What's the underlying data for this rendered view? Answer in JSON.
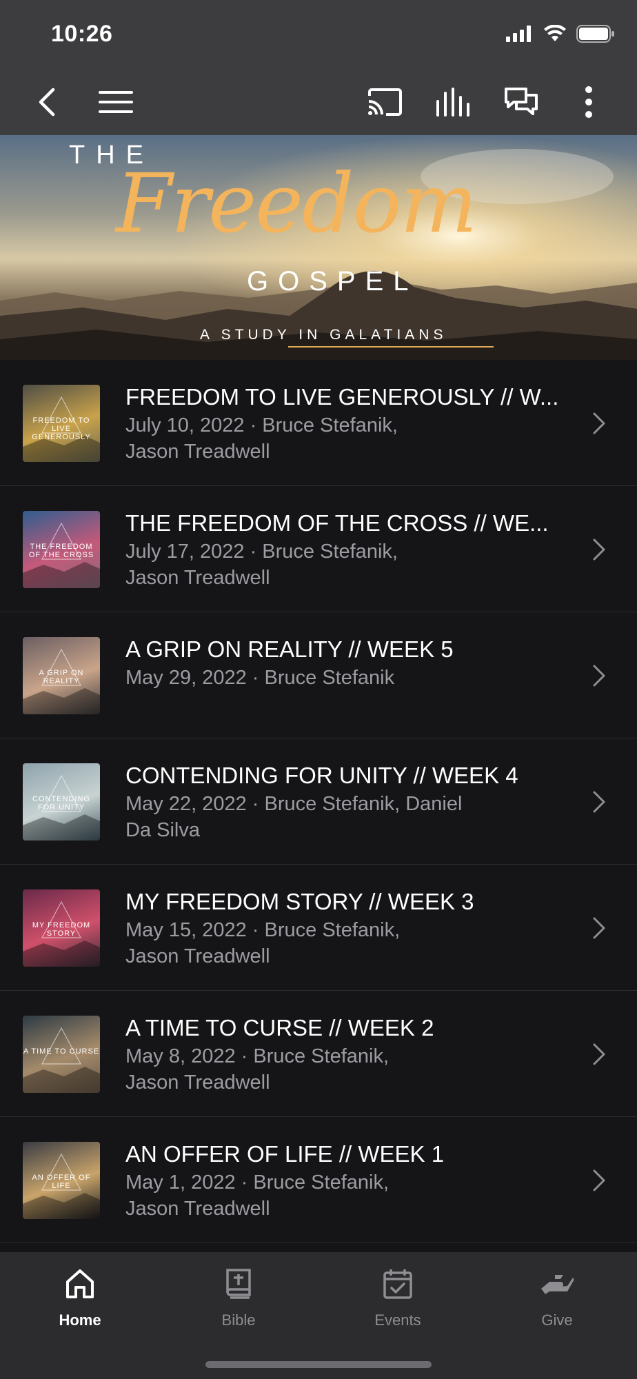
{
  "status_bar": {
    "time": "10:26"
  },
  "banner": {
    "line1": "THE",
    "line2": "Freedom",
    "line3": "GOSPEL",
    "line4": "A STUDY IN GALATIANS"
  },
  "sermons": [
    {
      "title": "FREEDOM TO LIVE GENEROUSLY // W...",
      "meta1": "July 10, 2022 · Bruce Stefanik,",
      "meta2": "Jason Treadwell",
      "thumb_caption": "FREEDOM TO LIVE GENEROUSLY",
      "thumb_colors": [
        "#4f4e46",
        "#c9a24a",
        "#6c6a52"
      ]
    },
    {
      "title": "THE FREEDOM OF THE CROSS // WE...",
      "meta1": "July 17, 2022 · Bruce Stefanik,",
      "meta2": "Jason Treadwell",
      "thumb_caption": "THE FREEDOM OF THE CROSS",
      "thumb_colors": [
        "#2f5d8f",
        "#c45a7a",
        "#8a6a7a"
      ]
    },
    {
      "title": "A GRIP ON REALITY // WEEK 5",
      "meta1": "May 29, 2022 · Bruce Stefanik",
      "meta2": "",
      "thumb_caption": "A GRIP ON REALITY",
      "thumb_colors": [
        "#6b5e62",
        "#c9a48a",
        "#3c3a3c"
      ]
    },
    {
      "title": "CONTENDING FOR UNITY // WEEK 4",
      "meta1": "May 22, 2022 · Bruce Stefanik, Daniel",
      "meta2": "Da Silva",
      "thumb_caption": "CONTENDING FOR UNITY",
      "thumb_colors": [
        "#8fa3ad",
        "#c8d3d2",
        "#445a64"
      ]
    },
    {
      "title": "MY FREEDOM STORY // WEEK 3",
      "meta1": "May 15, 2022 · Bruce Stefanik,",
      "meta2": "Jason Treadwell",
      "thumb_caption": "MY FREEDOM STORY",
      "thumb_colors": [
        "#6a2a4a",
        "#d0506a",
        "#3a2e3a"
      ]
    },
    {
      "title": "A TIME TO CURSE // WEEK 2",
      "meta1": "May 8, 2022 · Bruce Stefanik,",
      "meta2": "Jason Treadwell",
      "thumb_caption": "A TIME TO CURSE",
      "thumb_colors": [
        "#2d3a44",
        "#a48a6a",
        "#6a5a4a"
      ]
    },
    {
      "title": "AN OFFER OF LIFE // WEEK 1",
      "meta1": "May 1, 2022 · Bruce Stefanik,",
      "meta2": "Jason Treadwell",
      "thumb_caption": "AN OFFER OF LIFE",
      "thumb_colors": [
        "#3a3c44",
        "#c9a46a",
        "#1e1e22"
      ]
    }
  ],
  "nav": [
    {
      "label": "Home",
      "icon": "home-icon",
      "active": true
    },
    {
      "label": "Bible",
      "icon": "bible-icon",
      "active": false
    },
    {
      "label": "Events",
      "icon": "calendar-icon",
      "active": false
    },
    {
      "label": "Give",
      "icon": "give-icon",
      "active": false
    }
  ],
  "colors": {
    "background": "#151517",
    "app_bar": "#3d3d3f",
    "nav_bar": "#2c2c2e",
    "accent": "#f4b45c"
  }
}
